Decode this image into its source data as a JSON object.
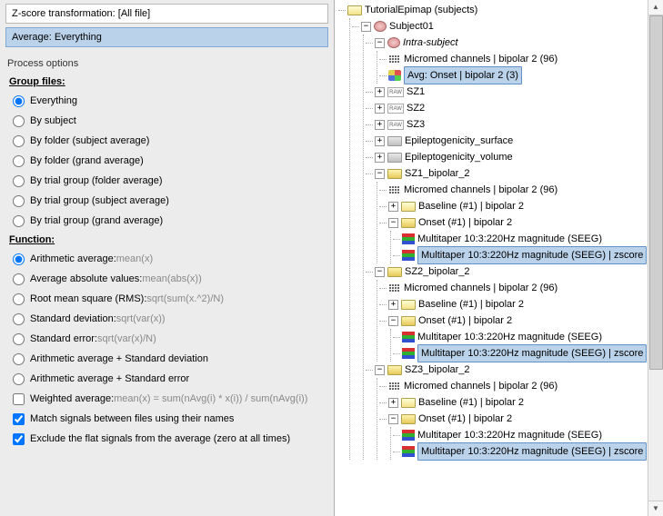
{
  "left": {
    "zscore_label": "Z-score transformation: [All file]",
    "avg_label": "Average: Everything",
    "process_options": "Process options",
    "group_files": "Group files:",
    "group": {
      "everything": "Everything",
      "by_subject": "By subject",
      "by_folder_subject_avg": "By folder (subject average)",
      "by_folder_grand_avg": "By folder (grand average)",
      "by_trial_folder_avg": "By trial group (folder average)",
      "by_trial_subject_avg": "By trial group (subject average)",
      "by_trial_grand_avg": "By trial group (grand average)"
    },
    "function_head": "Function:",
    "fn": {
      "arith_mean": "Arithmetic average:",
      "arith_mean_detail": " mean(x)",
      "avg_abs": "Average absolute values:",
      "avg_abs_detail": " mean(abs(x))",
      "rms": "Root mean square (RMS):",
      "rms_detail": " sqrt(sum(x.^2)/N)",
      "std": "Standard deviation:",
      "std_detail": " sqrt(var(x))",
      "se": "Standard error:",
      "se_detail": " sqrt(var(x)/N)",
      "mean_std": "Arithmetic average + Standard deviation",
      "mean_se": "Arithmetic average + Standard error",
      "weighted": "Weighted average:",
      "weighted_detail": " mean(x) = sum(nAvg(i) * x(i)) / sum(nAvg(i))",
      "match": "Match signals between files using their names",
      "exclude_flat": "Exclude the flat signals from the average (zero at all times)"
    }
  },
  "tree": {
    "root": "TutorialEpimap (subjects)",
    "subject": "Subject01",
    "intra": "Intra-subject",
    "micromed": "Micromed channels  | bipolar 2 (96)",
    "avg_onset": "Avg: Onset  | bipolar 2 (3)",
    "sz1": "SZ1",
    "sz2": "SZ2",
    "sz3": "SZ3",
    "epi_surf": "Epileptogenicity_surface",
    "epi_vol": "Epileptogenicity_volume",
    "sz1b": "SZ1_bipolar_2",
    "sz2b": "SZ2_bipolar_2",
    "sz3b": "SZ3_bipolar_2",
    "baseline": "Baseline (#1) | bipolar 2",
    "onset": "Onset (#1) | bipolar 2",
    "mt_mag": "Multitaper 10:3:220Hz magnitude (SEEG)",
    "mt_z": "Multitaper 10:3:220Hz magnitude (SEEG) | zscore"
  }
}
